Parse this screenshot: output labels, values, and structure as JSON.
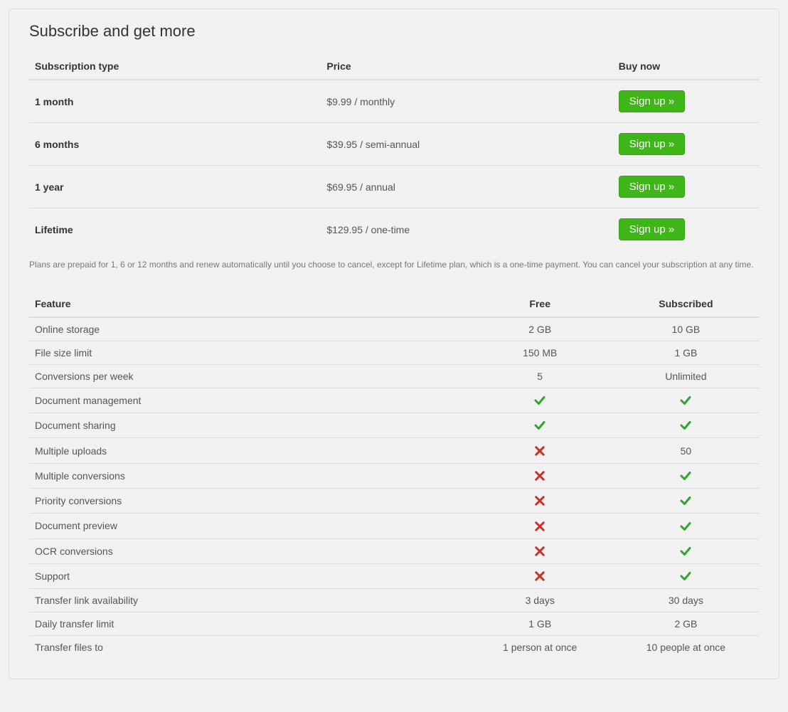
{
  "title": "Subscribe and get more",
  "subs": {
    "headers": [
      "Subscription type",
      "Price",
      "Buy now"
    ],
    "button_label": "Sign up »",
    "rows": [
      {
        "type": "1 month",
        "price": "$9.99 / monthly"
      },
      {
        "type": "6 months",
        "price": "$39.95 / semi-annual"
      },
      {
        "type": "1 year",
        "price": "$69.95 / annual"
      },
      {
        "type": "Lifetime",
        "price": "$129.95 / one-time"
      }
    ]
  },
  "note": "Plans are prepaid for 1, 6 or 12 months and renew automatically until you choose to cancel, except for Lifetime plan, which is a one-time payment. You can cancel your subscription at any time.",
  "features": {
    "headers": [
      "Feature",
      "Free",
      "Subscribed"
    ],
    "rows": [
      {
        "name": "Online storage",
        "free": "2 GB",
        "sub": "10 GB"
      },
      {
        "name": "File size limit",
        "free": "150 MB",
        "sub": "1 GB"
      },
      {
        "name": "Conversions per week",
        "free": "5",
        "sub": "Unlimited"
      },
      {
        "name": "Document management",
        "free": "check",
        "sub": "check"
      },
      {
        "name": "Document sharing",
        "free": "check",
        "sub": "check"
      },
      {
        "name": "Multiple uploads",
        "free": "cross",
        "sub": "50"
      },
      {
        "name": "Multiple conversions",
        "free": "cross",
        "sub": "check"
      },
      {
        "name": "Priority conversions",
        "free": "cross",
        "sub": "check"
      },
      {
        "name": "Document preview",
        "free": "cross",
        "sub": "check"
      },
      {
        "name": "OCR conversions",
        "free": "cross",
        "sub": "check"
      },
      {
        "name": "Support",
        "free": "cross",
        "sub": "check"
      },
      {
        "name": "Transfer link availability",
        "free": "3 days",
        "sub": "30 days"
      },
      {
        "name": "Daily transfer limit",
        "free": "1 GB",
        "sub": "2 GB"
      },
      {
        "name": "Transfer files to",
        "free": "1 person at once",
        "sub": "10 people at once"
      }
    ]
  }
}
